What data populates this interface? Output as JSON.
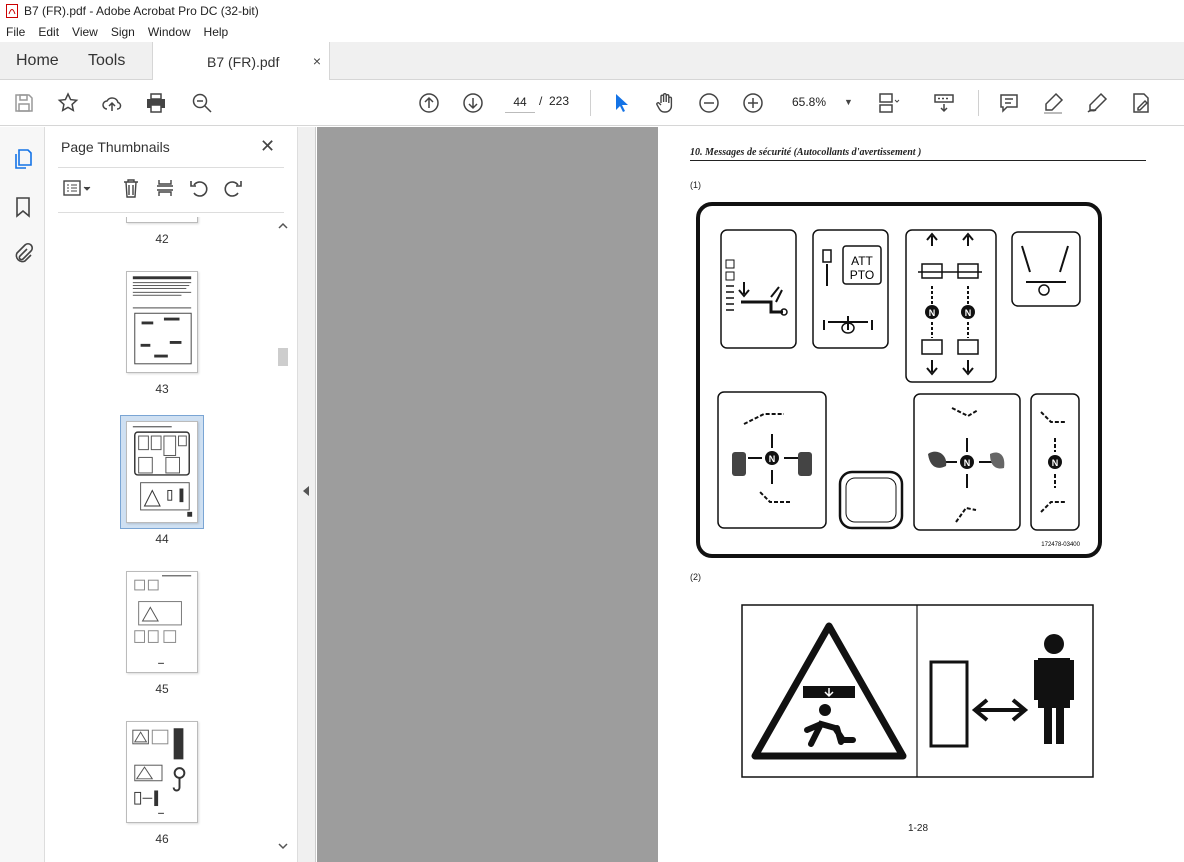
{
  "window": {
    "title": "B7  (FR).pdf - Adobe Acrobat Pro DC (32-bit)"
  },
  "menu": [
    "File",
    "Edit",
    "View",
    "Sign",
    "Window",
    "Help"
  ],
  "tabs": {
    "home": "Home",
    "tools": "Tools",
    "document": "B7  (FR).pdf",
    "close": "×"
  },
  "toolbar": {
    "current_page": "44",
    "separator": "/",
    "total_pages": "223",
    "zoom": "65.8%"
  },
  "panel": {
    "title": "Page Thumbnails",
    "close": "✕",
    "thumbnails": [
      {
        "label": "42"
      },
      {
        "label": "43"
      },
      {
        "label": "44",
        "selected": true
      },
      {
        "label": "45"
      },
      {
        "label": "46"
      }
    ]
  },
  "document": {
    "heading": "10. Messages de sécurité (Autocollants d'avertissement )",
    "label1": "(1)",
    "label2": "(2)",
    "sticker_att": "ATT",
    "sticker_pto": "PTO",
    "part_number": "172478-03400",
    "page_number": "1-28"
  },
  "colors": {
    "accent": "#1473e6",
    "viewer_bg": "#9d9d9d",
    "tabbar": "#f0f0f0"
  }
}
